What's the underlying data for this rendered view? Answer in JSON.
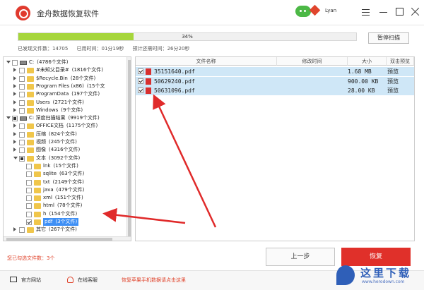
{
  "app": {
    "title": "金舟数据恢复软件",
    "user_name": "Lyan",
    "brand_color": "#e0302a"
  },
  "scan": {
    "progress_percent": 34,
    "progress_label": "34%",
    "pause_label": "暂停扫描",
    "found_label": "已发现文件数：14705",
    "elapsed_label": "已用时间：01分19秒",
    "remaining_label": "预计还需时间：26分20秒"
  },
  "tree": [
    {
      "label": "C:",
      "count": "(4786个文件)",
      "depth": 0,
      "icon": "drive",
      "expanded": true,
      "check": "none"
    },
    {
      "label": "#未知父目录#",
      "count": "(1816个文件)",
      "depth": 1,
      "icon": "folder",
      "expanded": false,
      "check": "none"
    },
    {
      "label": "$Recycle.Bin",
      "count": "(28个文件)",
      "depth": 1,
      "icon": "folder",
      "expanded": false,
      "check": "none"
    },
    {
      "label": "Program Files (x86)",
      "count": "(15个文",
      "depth": 1,
      "icon": "folder",
      "expanded": false,
      "check": "none"
    },
    {
      "label": "ProgramData",
      "count": "(197个文件)",
      "depth": 1,
      "icon": "folder",
      "expanded": false,
      "check": "none"
    },
    {
      "label": "Users",
      "count": "(2721个文件)",
      "depth": 1,
      "icon": "folder",
      "expanded": false,
      "check": "none"
    },
    {
      "label": "Windows",
      "count": "(9个文件)",
      "depth": 1,
      "icon": "folder",
      "expanded": false,
      "check": "none"
    },
    {
      "label": "C: 深度扫描结果",
      "count": "(9919个文件)",
      "depth": 0,
      "icon": "drive",
      "expanded": true,
      "check": "partial"
    },
    {
      "label": "OFFICE文档",
      "count": "(1175个文件)",
      "depth": 1,
      "icon": "folder",
      "expanded": false,
      "check": "none"
    },
    {
      "label": "压缩",
      "count": "(824个文件)",
      "depth": 1,
      "icon": "folder",
      "expanded": false,
      "check": "none"
    },
    {
      "label": "视频",
      "count": "(245个文件)",
      "depth": 1,
      "icon": "folder",
      "expanded": false,
      "check": "none"
    },
    {
      "label": "图像",
      "count": "(4316个文件)",
      "depth": 1,
      "icon": "folder",
      "expanded": false,
      "check": "none"
    },
    {
      "label": "文本",
      "count": "(3092个文件)",
      "depth": 1,
      "icon": "folder",
      "expanded": true,
      "check": "partial"
    },
    {
      "label": "lnk",
      "count": "(15个文件)",
      "depth": 2,
      "icon": "folder",
      "expanded": null,
      "check": "none"
    },
    {
      "label": "sqlite",
      "count": "(63个文件)",
      "depth": 2,
      "icon": "folder",
      "expanded": null,
      "check": "none"
    },
    {
      "label": "txt",
      "count": "(2149个文件)",
      "depth": 2,
      "icon": "folder",
      "expanded": null,
      "check": "none"
    },
    {
      "label": "java",
      "count": "(479个文件)",
      "depth": 2,
      "icon": "folder",
      "expanded": null,
      "check": "none"
    },
    {
      "label": "xml",
      "count": "(151个文件)",
      "depth": 2,
      "icon": "folder",
      "expanded": null,
      "check": "none"
    },
    {
      "label": "html",
      "count": "(78个文件)",
      "depth": 2,
      "icon": "folder",
      "expanded": null,
      "check": "none"
    },
    {
      "label": "h",
      "count": "(154个文件)",
      "depth": 2,
      "icon": "folder",
      "expanded": null,
      "check": "none"
    },
    {
      "label": "pdf",
      "count": "(3个文件)",
      "depth": 2,
      "icon": "folder",
      "expanded": null,
      "check": "checked",
      "selected": true
    },
    {
      "label": "其它",
      "count": "(267个文件)",
      "depth": 1,
      "icon": "folder",
      "expanded": false,
      "check": "none"
    }
  ],
  "file_table": {
    "headers": [
      "文件名称",
      "修改时间",
      "大小",
      "双击预览"
    ],
    "rows": [
      {
        "name": "35151640.pdf",
        "modified": "",
        "size": "1.68 MB",
        "preview": "预览",
        "checked": true
      },
      {
        "name": "50629240.pdf",
        "modified": "",
        "size": "900.00 KB",
        "preview": "预览",
        "checked": true
      },
      {
        "name": "50631096.pdf",
        "modified": "",
        "size": "28.00 KB",
        "preview": "预览",
        "checked": true
      }
    ]
  },
  "bottom": {
    "selected_count": "您已勾选文件数：3个",
    "prev_label": "上一步",
    "recover_label": "恢复"
  },
  "footer": {
    "website_label": "官方网站",
    "support_label": "在线客服",
    "promo_label": "恢复苹果手机数据请点击这里"
  },
  "watermark": {
    "text": "这里下载",
    "url": "www.herodown.com"
  }
}
